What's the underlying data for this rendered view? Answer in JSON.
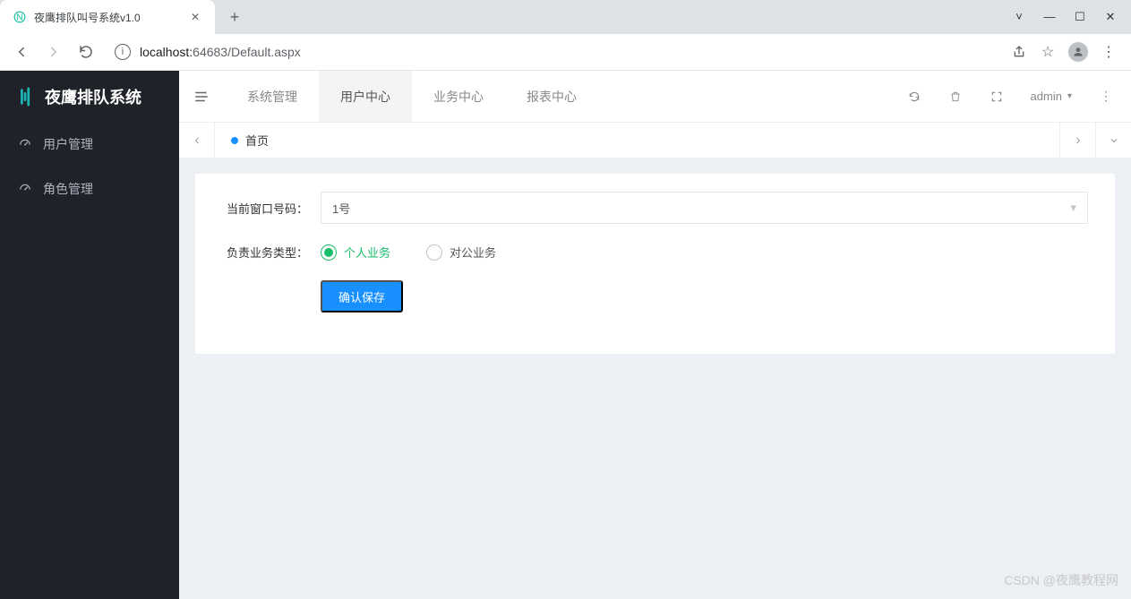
{
  "browser": {
    "tab_title": "夜鹰排队叫号系统v1.0",
    "url_host": "localhost:",
    "url_port": "64683",
    "url_path": "/Default.aspx"
  },
  "app": {
    "brand": "夜鹰排队系统",
    "sidebar": [
      {
        "label": "用户管理"
      },
      {
        "label": "角色管理"
      }
    ],
    "topnav": [
      {
        "label": "系统管理"
      },
      {
        "label": "用户中心",
        "active": true
      },
      {
        "label": "业务中心"
      },
      {
        "label": "报表中心"
      }
    ],
    "user": "admin",
    "page_tab": "首页",
    "form": {
      "window_label": "当前窗口号码：",
      "window_value": "1号",
      "bus_type_label": "负责业务类型：",
      "radio_personal": "个人业务",
      "radio_corporate": "对公业务",
      "save_label": "确认保存"
    }
  },
  "watermark": "CSDN @夜鹰教程网"
}
